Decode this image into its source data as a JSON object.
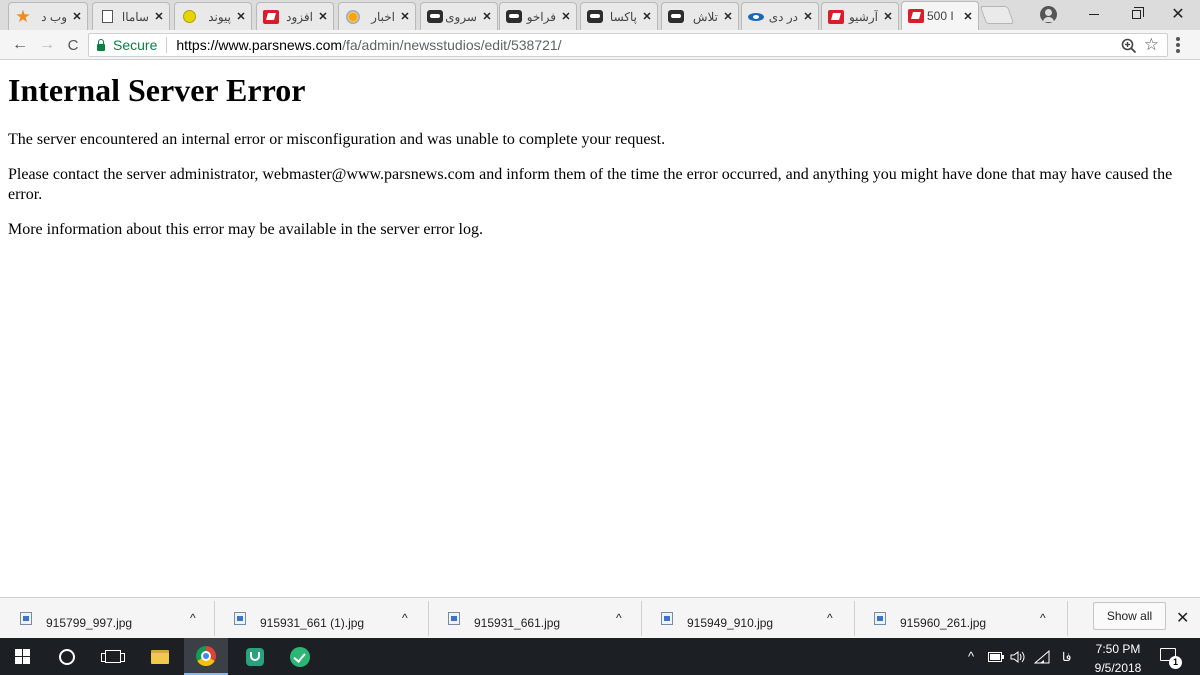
{
  "browser": {
    "tabs": [
      {
        "title": "وب د",
        "icon": "orange-star-icon",
        "active": false
      },
      {
        "title": "ساماا",
        "icon": "document-icon",
        "active": false
      },
      {
        "title": "پیوند",
        "icon": "yellow-ball-icon",
        "active": false
      },
      {
        "title": "افزود",
        "icon": "red-logo-icon",
        "active": false
      },
      {
        "title": "اخبار",
        "icon": "sun-logo-icon",
        "active": false
      },
      {
        "title": "سروی",
        "icon": "dark-logo-icon",
        "active": false
      },
      {
        "title": "فراخو",
        "icon": "dark-logo-icon",
        "active": false
      },
      {
        "title": "پاکسا",
        "icon": "dark-logo-icon",
        "active": false
      },
      {
        "title": "تلاش",
        "icon": "dark-logo-icon",
        "active": false
      },
      {
        "title": "در دی",
        "icon": "blue-logo-icon",
        "active": false
      },
      {
        "title": "آرشیو",
        "icon": "red-logo-icon",
        "active": false
      },
      {
        "title": "500 I",
        "icon": "red-logo-icon",
        "active": true
      }
    ],
    "tab_close_glyph": "✕",
    "omnibox": {
      "secure_label": "Secure",
      "url_host": "https://www.parsnews.com",
      "url_path": "/fa/admin/newsstudios/edit/538721/"
    },
    "nav": {
      "back": "←",
      "forward": "→",
      "reload": "C"
    },
    "star_glyph": "☆"
  },
  "page": {
    "heading": "Internal Server Error",
    "paragraphs": [
      "The server encountered an internal error or misconfiguration and was unable to complete your request.",
      "Please contact the server administrator, webmaster@www.parsnews.com and inform them of the time the error occurred, and anything you might have done that may have caused the error.",
      "More information about this error may be available in the server error log."
    ]
  },
  "downloads": {
    "items": [
      {
        "name": "915799_997.jpg"
      },
      {
        "name": "915931_661 (1).jpg"
      },
      {
        "name": "915931_661.jpg"
      },
      {
        "name": "915949_910.jpg"
      },
      {
        "name": "915960_261.jpg"
      }
    ],
    "chevron_glyph": "^",
    "show_all_label": "Show all",
    "close_glyph": "✕"
  },
  "taskbar": {
    "time": "7:50 PM",
    "date": "9/5/2018",
    "language": "فا",
    "notification_count": "1",
    "tray_up_glyph": "^"
  },
  "colors": {
    "secure_green": "#0b8043",
    "taskbar_bg": "#1c1f24",
    "tab_strip_bg": "#dcdcdc"
  }
}
